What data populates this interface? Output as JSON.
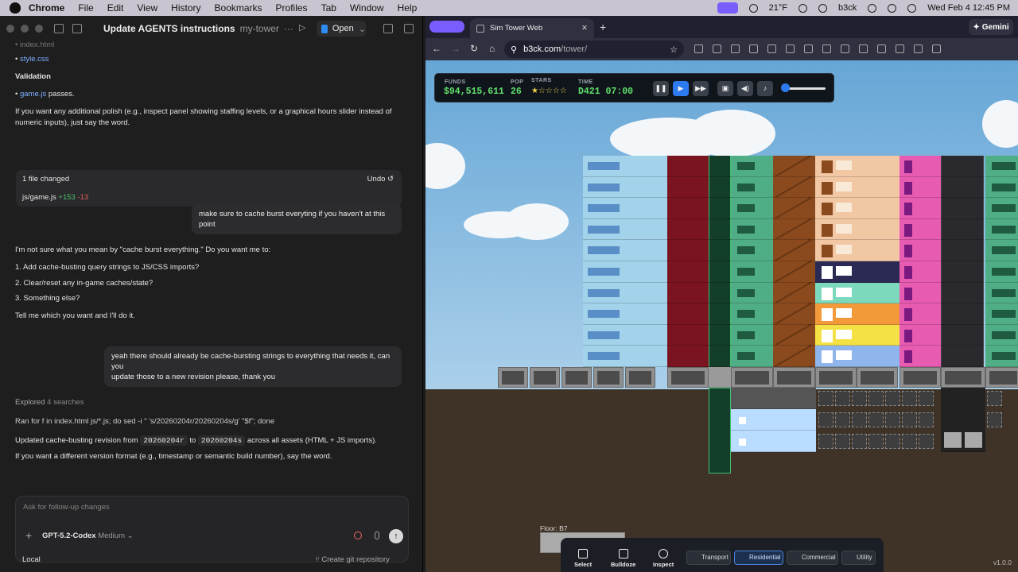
{
  "menubar": {
    "items": [
      "Chrome",
      "File",
      "Edit",
      "View",
      "History",
      "Bookmarks",
      "Profiles",
      "Tab",
      "Window",
      "Help"
    ],
    "weather": "21°F",
    "user": "b3ck",
    "datetime": "Wed Feb 4  12:45 PM"
  },
  "codex": {
    "title": "Update AGENTS instructions",
    "project": "my-tower",
    "open_label": "Open",
    "lines": {
      "file_index": "index.html",
      "file_style": "style.css",
      "validation_heading": "Validation",
      "validation_file": "game.js",
      "validation_rest": "passes.",
      "polish_1": "If you want any additional polish (e.g., inspect panel showing staffing levels, or a graphical hours slider instead of",
      "polish_2": "numeric inputs), just say the word."
    },
    "changes": {
      "title": "1 file changed",
      "undo": "Undo",
      "file": "js/game.js",
      "added": "+153",
      "removed": "-13"
    },
    "user_msg_1": "make sure to cache burst everyting if you haven't at this point",
    "reply1": {
      "intro": "I'm not sure what you mean by \"cache burst everything.\" Do you want me to:",
      "opt1": "1. Add cache-busting query strings to JS/CSS imports?",
      "opt2": "2. Clear/reset any in-game caches/state?",
      "opt3": "3. Something else?",
      "closing": "Tell me which you want and I'll do it."
    },
    "user_msg_2_line1": "yeah there should already be cache-bursting strings to everything that needs it, can you",
    "user_msg_2_line2": "update those to a new revision please, thank you",
    "explored": "Explored",
    "explored_count": "4 searches",
    "command": "Ran for f in index.html js/*.js; do sed -i '' 's/20260204r/20260204s/g' \"$f\"; done",
    "updated_pre": "Updated cache-busting revision from",
    "old_rev": "20260204r",
    "to": "to",
    "new_rev": "20260204s",
    "updated_post": "across all assets (HTML + JS imports).",
    "different_format": "If you want a different version format (e.g., timestamp or semantic build number), say the word.",
    "composer_placeholder": "Ask for follow-up changes",
    "model": "GPT-5.2-Codex",
    "effort": "Medium",
    "footer_local": "Local",
    "footer_git": "Create git repository"
  },
  "browser": {
    "tab_title": "Sim Tower Web",
    "gemini": "Gemini",
    "url_host": "b3ck.com",
    "url_path": "/tower/"
  },
  "game": {
    "hud": {
      "funds_label": "FUNDS",
      "funds": "$94,515,611",
      "pop_label": "POP",
      "pop": "26",
      "stars_label": "STARS",
      "stars": "★☆☆☆☆",
      "time_label": "TIME",
      "time": "D421 07:00",
      "volume_level": 0.08
    },
    "floor_label": "Floor: B7",
    "tools": [
      "Select",
      "Bulldoze",
      "Inspect"
    ],
    "categories": [
      "Transport",
      "Residential",
      "Commercial",
      "Utility"
    ],
    "selected_category": "Residential",
    "version": "v1.0.0"
  }
}
